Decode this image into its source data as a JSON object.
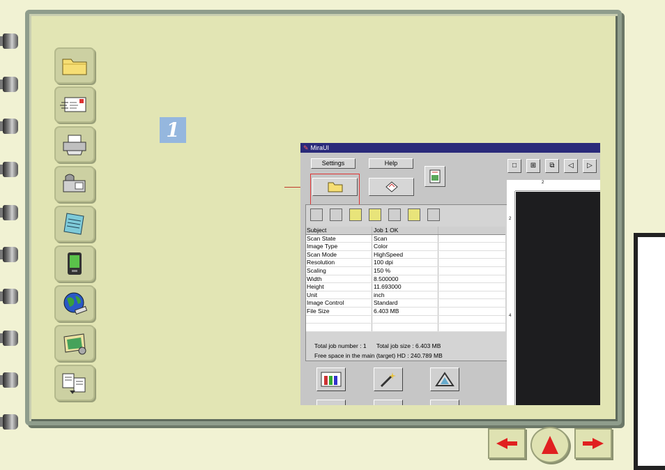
{
  "sidebar_icons": [
    {
      "name": "folder-icon"
    },
    {
      "name": "mail-icon"
    },
    {
      "name": "printer-icon"
    },
    {
      "name": "fax-icon"
    },
    {
      "name": "notepad-icon"
    },
    {
      "name": "pda-icon"
    },
    {
      "name": "globe-icon"
    },
    {
      "name": "image-edit-icon"
    },
    {
      "name": "copy-documents-icon"
    }
  ],
  "step_number": "1",
  "window": {
    "title": "MiraUI",
    "settings_label": "Settings",
    "help_label": "Help",
    "table": {
      "headers": [
        "Subject",
        "Job 1   OK",
        ""
      ],
      "rows": [
        [
          "Scan State",
          "Scan"
        ],
        [
          "Image Type",
          "Color"
        ],
        [
          "Scan Mode",
          "HighSpeed"
        ],
        [
          "Resolution",
          "100 dpi"
        ],
        [
          "Scaling",
          "150 %"
        ],
        [
          "Width",
          "8.500000"
        ],
        [
          "Height",
          "11.693000"
        ],
        [
          "Unit",
          "inch"
        ],
        [
          "Image Control",
          "Standard"
        ],
        [
          "File Size",
          "6.403   MB"
        ]
      ]
    },
    "total_job_number_label": "Total job number :  1",
    "total_job_size_label": "Total job size       :  6.403   MB",
    "free_space_label": "Free space in the main (target) HD         :     240.789 MB",
    "ruler_mark_top": "2",
    "ruler_mark_left_1": "2",
    "ruler_mark_left_2": "4"
  },
  "colors": {
    "page_bg": "#e2e5b4",
    "accent_step": "#95b7de",
    "nav_arrow": "#e02020"
  }
}
